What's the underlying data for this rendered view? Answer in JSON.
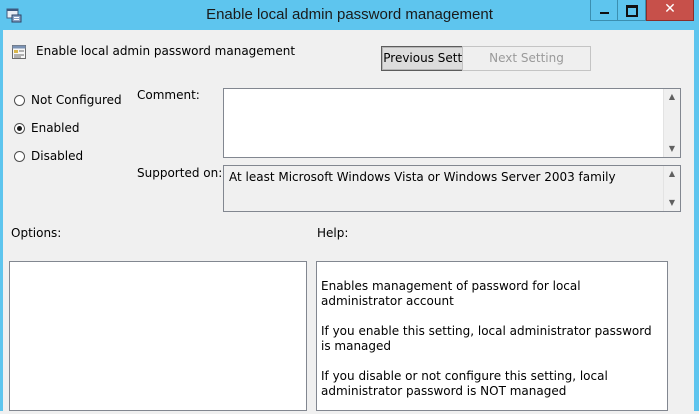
{
  "window": {
    "title": "Enable local admin password management",
    "close_glyph": "✕"
  },
  "policy": {
    "name": "Enable local admin password management"
  },
  "nav": {
    "previous_label": "Previous Setting",
    "next_label": "Next Setting"
  },
  "state": {
    "options": [
      {
        "label": "Not Configured",
        "checked": false
      },
      {
        "label": "Enabled",
        "checked": true
      },
      {
        "label": "Disabled",
        "checked": false
      }
    ]
  },
  "comment": {
    "label": "Comment:",
    "value": ""
  },
  "supported": {
    "label": "Supported on:",
    "value": "At least Microsoft Windows Vista or Windows Server 2003 family"
  },
  "options_section": {
    "label": "Options:"
  },
  "help_section": {
    "label": "Help:",
    "paragraphs": [
      "Enables management of password for local administrator account",
      "If you enable this setting, local administrator password is managed",
      "If you disable or not configure this setting, local administrator password is NOT managed"
    ]
  },
  "icons": {
    "app": "group-policy-editor-icon",
    "policy": "policy-setting-icon",
    "scroll_up": "scroll-up-arrow-icon",
    "scroll_down": "scroll-down-arrow-icon"
  }
}
